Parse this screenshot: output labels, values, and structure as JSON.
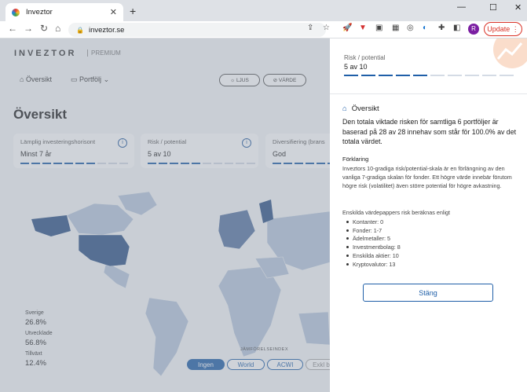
{
  "browser": {
    "tab_title": "Inveztor",
    "url": "inveztor.se",
    "update_label": "Update",
    "profile_initial": "R"
  },
  "app": {
    "logo": "INVEZTOR",
    "logo_sub": "PREMIUM",
    "menu": {
      "overview": "Översikt",
      "portfolio": "Portfölj"
    },
    "pills": {
      "light": "LJUS",
      "value": "VÄRDE"
    },
    "page_title": "Översikt",
    "cards": [
      {
        "title": "Lämplig investeringshorisont",
        "value": "Minst 7 år",
        "level": 7,
        "max": 10
      },
      {
        "title": "Risk / potential",
        "value": "5 av 10",
        "level": 5,
        "max": 10
      },
      {
        "title": "Diversifiering (brans",
        "value": "God",
        "level": 10,
        "max": 10
      }
    ],
    "stats": [
      {
        "label": "Sverige",
        "value": "26.8%"
      },
      {
        "label": "Utvecklade",
        "value": "56.8%"
      },
      {
        "label": "Tillväxt",
        "value": "12.4%"
      }
    ],
    "comparison": {
      "title": "JÄMFÖRELSEINDEX",
      "options": [
        "Ingen",
        "World",
        "ACWI",
        "Exkl b"
      ],
      "selected": "Ingen"
    }
  },
  "panel": {
    "metric_title": "Risk / potential",
    "metric_value": "5 av 10",
    "level": 5,
    "max": 10,
    "section_title": "Översikt",
    "lead": "Den totala viktade risken för samtliga 6 portföljer är baserad på 28 av 28 innehav som står för 100.0% av det totala värdet.",
    "explain_title": "Förklaring",
    "explain_text": "Inveztors 10-gradiga risk/potential-skala är en förlängning av den vanliga 7-gradiga skalan för fonder. Ett högre värde innebär förutom högre risk (volatilitet) även större potential för högre avkastning.",
    "list_title": "Enskilda värdepappers risk beräknas enligt",
    "list": [
      "Kontanter: 0",
      "Fonder: 1-7",
      "Ädelmetaller: 5",
      "Investmentbolag: 8",
      "Enskilda aktier: 10",
      "Kryptovalutor: 13"
    ],
    "close_label": "Stäng"
  }
}
